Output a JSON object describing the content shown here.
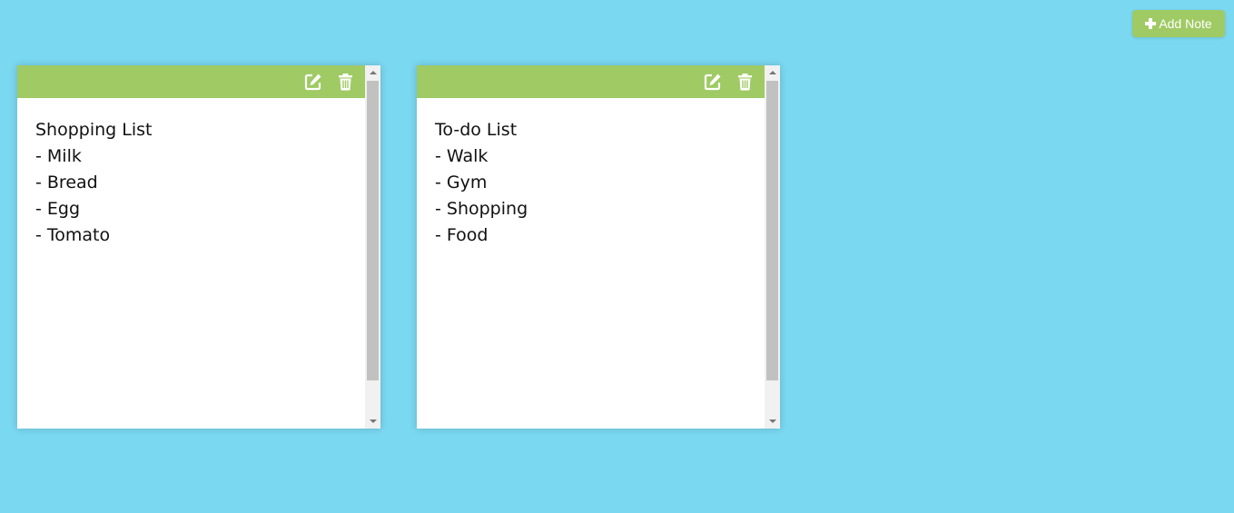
{
  "toolbar": {
    "add_note_label": "Add Note",
    "add_icon": "plus-icon"
  },
  "colors": {
    "background": "#7ad8f0",
    "accent_green": "#9fca64",
    "note_background": "#ffffff",
    "text": "#111111"
  },
  "notes": [
    {
      "title": "Shopping List",
      "content": "Shopping List\n- Milk\n- Bread\n- Egg\n- Tomato",
      "edit_icon": "edit-icon",
      "delete_icon": "trash-icon"
    },
    {
      "title": "To-do List",
      "content": "To-do List\n- Walk\n- Gym\n- Shopping\n- Food",
      "edit_icon": "edit-icon",
      "delete_icon": "trash-icon"
    }
  ]
}
